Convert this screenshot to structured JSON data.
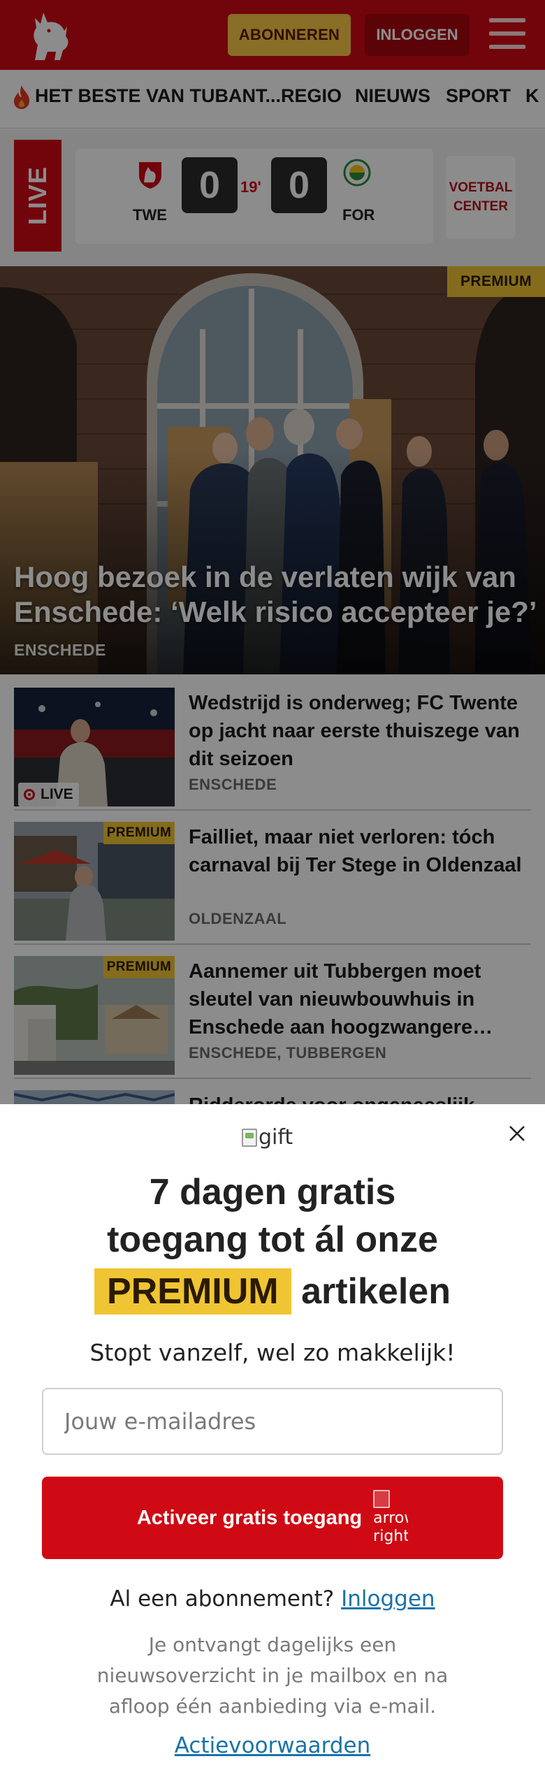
{
  "header": {
    "brand_color": "#cf0a14",
    "subscribe_label": "ABONNEREN",
    "login_label": "INLOGGEN",
    "logo_icon": "horse-logo-icon",
    "menu_icon": "hamburger-menu-icon"
  },
  "nav": {
    "items": [
      "HET BESTE VAN TUBANT...",
      "REGIO",
      "NIEUWS",
      "SPORT",
      "K"
    ]
  },
  "live": {
    "label": "LIVE",
    "home_team": "TWE",
    "away_team": "FOR",
    "home_score": "0",
    "away_score": "0",
    "minute": "19'",
    "center_label_1": "VOETBAL",
    "center_label_2": "CENTER"
  },
  "hero": {
    "badge": "PREMIUM",
    "title": "Hoog bezoek in de verlaten wijk van Enschede: ‘Welk risico accepteer je?’",
    "place": "ENSCHEDE"
  },
  "articles": [
    {
      "title": "Wedstrijd is onderweg; FC Twente op jacht naar eerste thuiszege van dit seizoen",
      "place": "ENSCHEDE",
      "chip": "LIVE"
    },
    {
      "title": "Failliet, maar niet verloren: tóch carnaval bij Ter Stege in Oldenzaal",
      "place": "OLDENZAAL",
      "badge": "PREMIUM"
    },
    {
      "title": "Aannemer uit Tubbergen moet sleutel van nieuwbouwhuis in Enschede aan hoogzwangere…",
      "place": "ENSCHEDE, TUBBERGEN",
      "badge": "PREMIUM"
    },
    {
      "title": "Ridderorde voor ongeneeslijk"
    }
  ],
  "modal": {
    "gift_alt": "gift",
    "title_line1": "7 dagen gratis",
    "title_line2": "toegang tot ál onze",
    "title_premium": "PREMIUM",
    "title_rest": "artikelen",
    "subline": "Stopt vanzelf, wel zo makkelijk!",
    "email_placeholder": "Jouw e-mailadres",
    "cta_label": "Activeer gratis toegang",
    "cta_arrow_alt": "arrow-right",
    "already_text": "Al een abonnement?",
    "already_link": "Inloggen",
    "disclaimer": "Je ontvangt dagelijks een nieuwsoverzicht in je mailbox en na afloop één aanbieding via e-mail.",
    "terms_link": "Actievoorwaarden",
    "close_icon": "close-icon"
  }
}
